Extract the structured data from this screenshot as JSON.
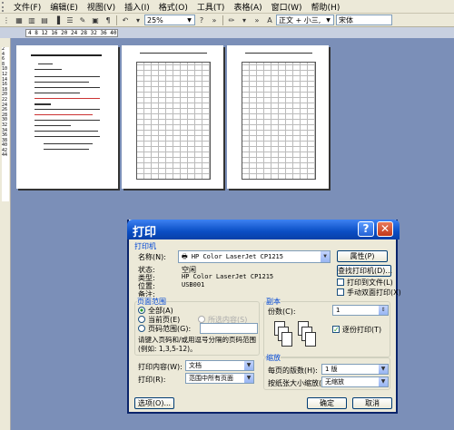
{
  "menu": [
    "文件(F)",
    "编辑(E)",
    "视图(V)",
    "插入(I)",
    "格式(O)",
    "工具(T)",
    "表格(A)",
    "窗口(W)",
    "帮助(H)"
  ],
  "toolbar": {
    "zoom": "25%",
    "style": "正文 + 小三,",
    "font": "宋体"
  },
  "ruler": {
    "text": "4  8  12  16  20  24  28  32  36  40  44  48"
  },
  "vruler": {
    "text": "2 4 6 8 10 12 14 16 18 20 22 24 26 28 30 32 34 36 38 40 42 44"
  },
  "dialog": {
    "title": "打印",
    "printer_group": "打印机",
    "name_label": "名称(N):",
    "printer_name": "HP Color LaserJet CP1215",
    "status_label": "状态:",
    "status_value": "空闲",
    "type_label": "类型:",
    "type_value": "HP Color LaserJet CP1215",
    "where_label": "位置:",
    "where_value": "USB001",
    "comment_label": "备注:",
    "properties_btn": "属性(P)",
    "find_printer_btn": "查找打印机(D)...",
    "print_to_file": "打印到文件(L)",
    "manual_duplex": "手动双面打印(X)",
    "range_group": "页面范围",
    "all_pages": "全部(A)",
    "current_page": "当前页(E)",
    "selection": "所选内容(S)",
    "page_range": "页码范围(G):",
    "range_hint": "请键入页码和/或用逗号分隔的页码范围(例如: 1,3,5-12)。",
    "copies_group": "副本",
    "copies_label": "份数(C):",
    "copies_value": "1",
    "collate": "逐份打印(T)",
    "print_what_label": "打印内容(W):",
    "print_what_value": "文档",
    "print_label": "打印(R):",
    "print_value": "范围中所有页面",
    "zoom_group": "缩放",
    "pages_per_sheet_label": "每页的版数(H):",
    "pages_per_sheet_value": "1 版",
    "scale_label": "按纸张大小缩放(Z):",
    "scale_value": "无缩放",
    "options_btn": "选项(O)...",
    "ok_btn": "确定",
    "cancel_btn": "取消"
  }
}
